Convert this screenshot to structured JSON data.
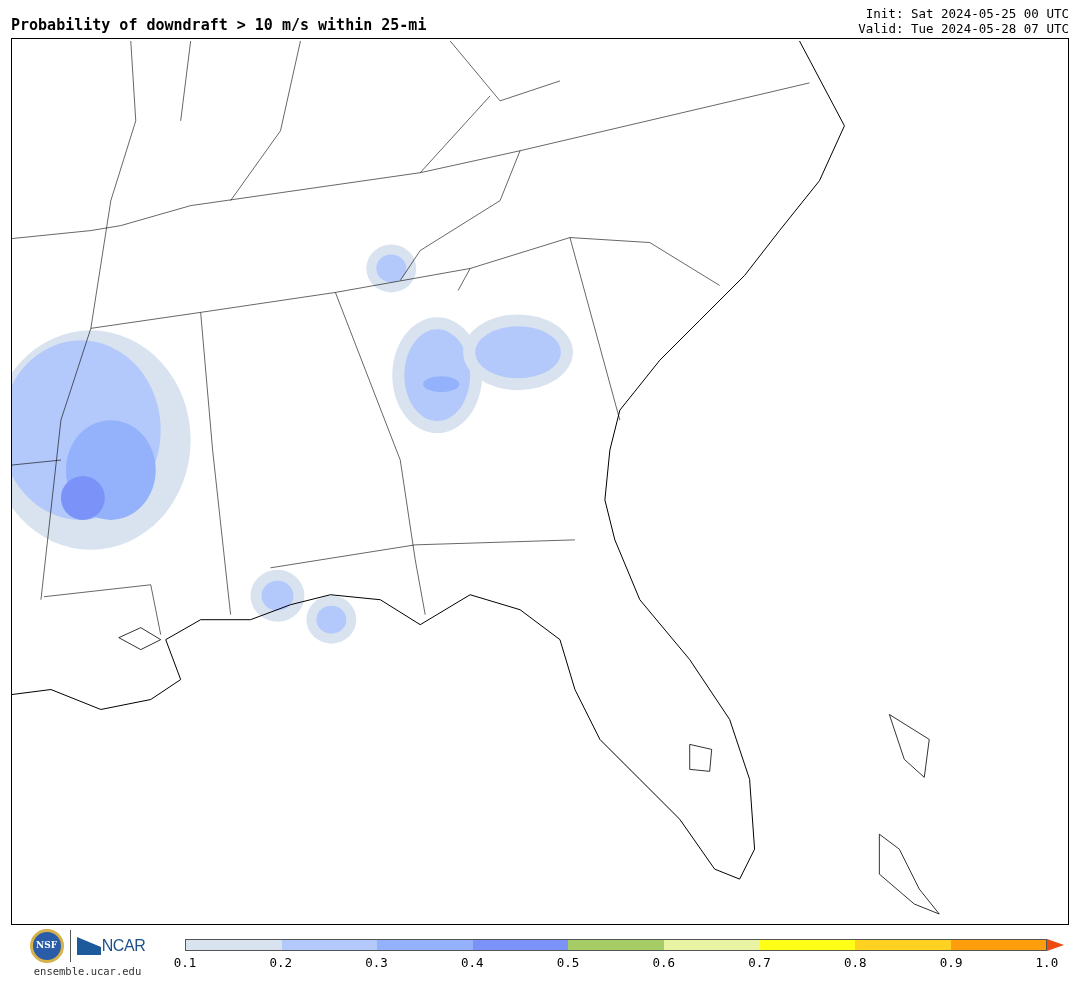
{
  "title": "Probability of downdraft > 10 m/s within 25-mi",
  "init": "Init: Sat 2024-05-25 00 UTC",
  "valid": "Valid: Tue 2024-05-28 07 UTC",
  "logos": {
    "nsf": "NSF",
    "ncar": "NCAR"
  },
  "site": "ensemble.ucar.edu",
  "colorbar": {
    "segments": [
      {
        "kind": "box",
        "color": "#d9e3ef"
      },
      {
        "kind": "box",
        "color": "#b3c8fb"
      },
      {
        "kind": "box",
        "color": "#93b2fb"
      },
      {
        "kind": "box",
        "color": "#7b93f8"
      },
      {
        "kind": "box",
        "color": "#a6cc66"
      },
      {
        "kind": "box",
        "color": "#e8f4a4"
      },
      {
        "kind": "box",
        "color": "#ffff18"
      },
      {
        "kind": "box",
        "color": "#ffd221"
      },
      {
        "kind": "box",
        "color": "#ff9e0c"
      },
      {
        "kind": "arrow",
        "color": "#ef4a10"
      }
    ],
    "ticks": [
      "0.1",
      "0.2",
      "0.3",
      "0.4",
      "0.5",
      "0.6",
      "0.7",
      "0.8",
      "0.9",
      "1.0"
    ]
  }
}
